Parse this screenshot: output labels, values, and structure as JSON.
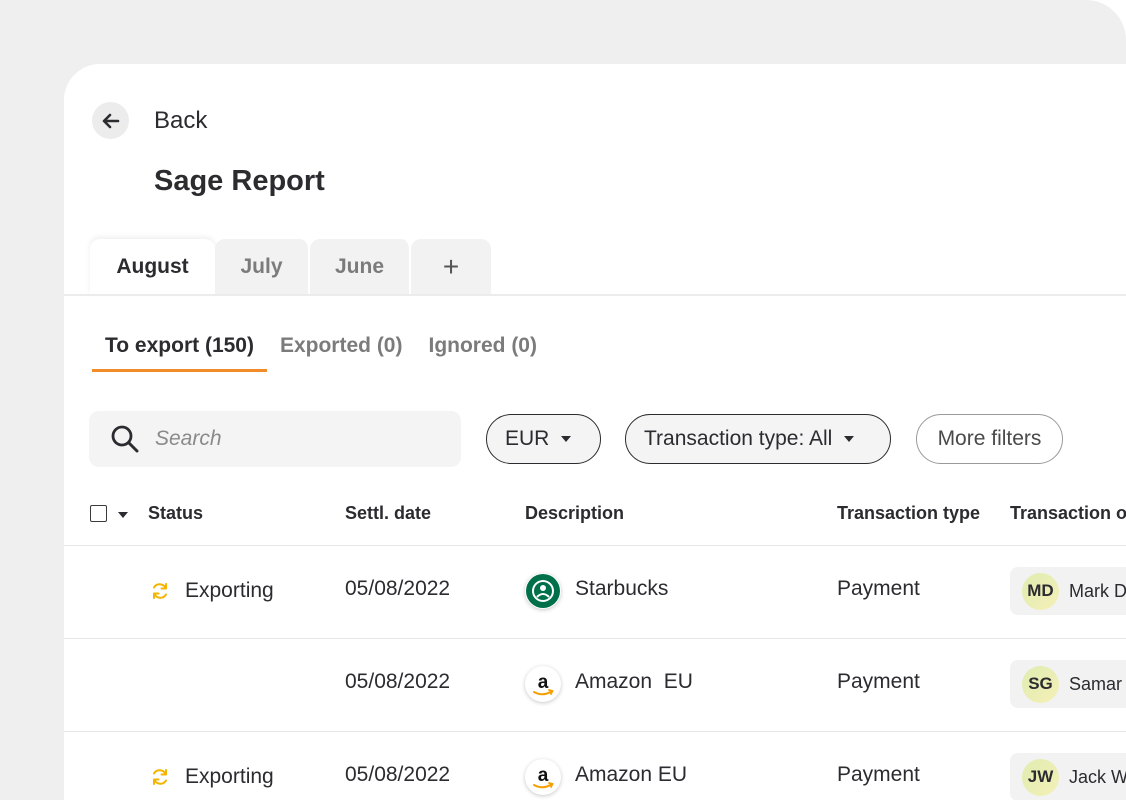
{
  "back_label": "Back",
  "title": "Sage Report",
  "months": [
    "August",
    "July",
    "June"
  ],
  "add_tab_label": "+",
  "sub_tabs": [
    "To export (150)",
    "Exported (0)",
    "Ignored (0)"
  ],
  "search_placeholder": "Search",
  "filters": {
    "currency": "EUR",
    "transaction_type": "Transaction type: All",
    "more": "More filters"
  },
  "columns": [
    "Status",
    "Settl. date",
    "Description",
    "Transaction type",
    "Transaction o"
  ],
  "rows": [
    {
      "status": "Exporting",
      "date": "05/08/2022",
      "description": "Starbucks",
      "type": "Payment",
      "owner_initials": "MD",
      "owner_name": "Mark D"
    },
    {
      "status": "",
      "date": "05/08/2022",
      "description": "Amazon  EU",
      "type": "Payment",
      "owner_initials": "SG",
      "owner_name": "Samar"
    },
    {
      "status": "Exporting",
      "date": "05/08/2022",
      "description": "Amazon EU",
      "type": "Payment",
      "owner_initials": "JW",
      "owner_name": "Jack W"
    }
  ],
  "colors": {
    "accent": "#f28c28",
    "starbucks": "#00704a",
    "sync": "#f5b400"
  }
}
